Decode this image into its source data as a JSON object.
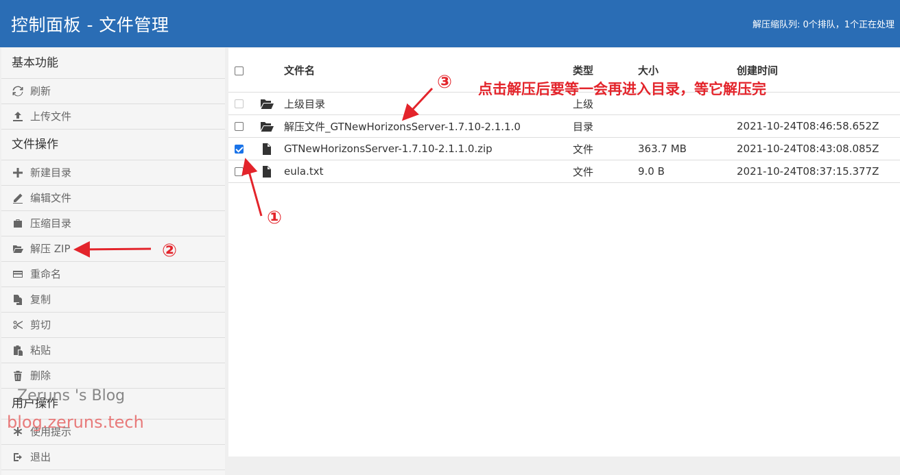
{
  "header": {
    "title": "控制面板 - 文件管理",
    "queue_status": "解压缩队列: 0个排队，1个正在处理"
  },
  "sidebar": {
    "sections": [
      {
        "title": "基本功能",
        "items": [
          {
            "label": "刷新",
            "icon": "refresh-icon"
          },
          {
            "label": "上传文件",
            "icon": "upload-icon"
          }
        ]
      },
      {
        "title": "文件操作",
        "items": [
          {
            "label": "新建目录",
            "icon": "plus-icon"
          },
          {
            "label": "编辑文件",
            "icon": "pencil-icon"
          },
          {
            "label": "压缩目录",
            "icon": "briefcase-icon"
          },
          {
            "label": "解压 ZIP",
            "icon": "folder-open-icon"
          },
          {
            "label": "重命名",
            "icon": "card-icon"
          },
          {
            "label": "复制",
            "icon": "copy-icon"
          },
          {
            "label": "剪切",
            "icon": "scissors-icon"
          },
          {
            "label": "粘贴",
            "icon": "paste-icon"
          },
          {
            "label": "删除",
            "icon": "trash-icon"
          }
        ]
      },
      {
        "title": "用户操作",
        "items": [
          {
            "label": "使用提示",
            "icon": "asterisk-icon"
          },
          {
            "label": "退出",
            "icon": "logout-icon"
          }
        ]
      }
    ]
  },
  "table": {
    "headers": {
      "name": "文件名",
      "type": "类型",
      "size": "大小",
      "created": "创建时间"
    },
    "rows": [
      {
        "name": "上级目录",
        "type": "上级",
        "size": "",
        "created": "",
        "icon": "folder-open-icon",
        "checked": false,
        "disabled": true
      },
      {
        "name": "解压文件_GTNewHorizonsServer-1.7.10-2.1.1.0",
        "type": "目录",
        "size": "",
        "created": "2021-10-24T08:46:58.652Z",
        "icon": "folder-open-icon",
        "checked": false,
        "disabled": false
      },
      {
        "name": "GTNewHorizonsServer-1.7.10-2.1.1.0.zip",
        "type": "文件",
        "size": "363.7 MB",
        "created": "2021-10-24T08:43:08.085Z",
        "icon": "file-icon",
        "checked": true,
        "disabled": false
      },
      {
        "name": "eula.txt",
        "type": "文件",
        "size": "9.0 B",
        "created": "2021-10-24T08:37:15.377Z",
        "icon": "file-icon",
        "checked": false,
        "disabled": false
      }
    ]
  },
  "annotations": {
    "step1": "①",
    "step2": "②",
    "step3": "③",
    "note": "点击解压后要等一会再进入目录，等它解压完"
  },
  "watermark": {
    "line1": "Zeruns 's Blog",
    "line2": "blog.zeruns.tech"
  },
  "colors": {
    "header_bg": "#2a6db5",
    "annotation_red": "#e3242b",
    "checkbox_blue": "#1a73e8"
  }
}
